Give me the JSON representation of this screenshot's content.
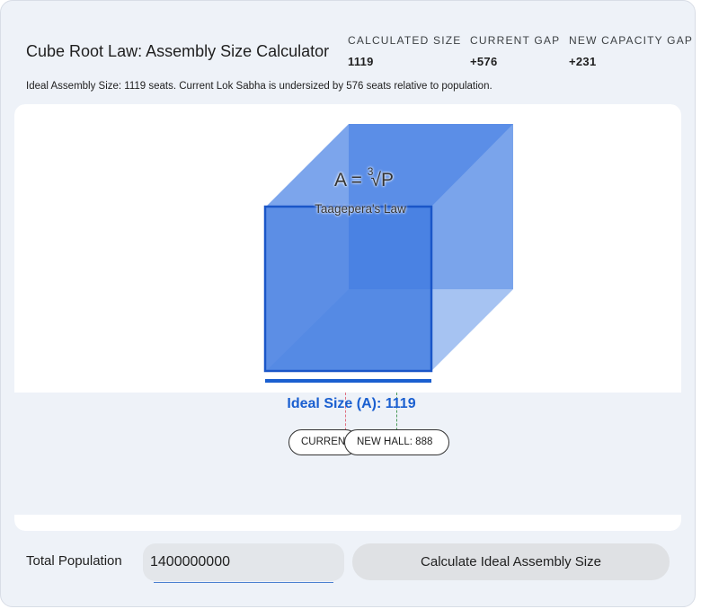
{
  "header": {
    "title": "Cube Root Law: Assembly Size Calculator",
    "stats": [
      {
        "label": "Calculated Size",
        "value": "1119"
      },
      {
        "label": "Current Gap",
        "value": "+576"
      },
      {
        "label": "New Capacity Gap",
        "value": "+231"
      }
    ],
    "summary": "Ideal Assembly Size: 1119 seats. Current Lok Sabha is undersized by 576 seats relative to population."
  },
  "visual": {
    "formula_prefix": "A = ",
    "formula_index": "3",
    "formula_radical": "√",
    "formula_var": "P",
    "law_name": "Taagepera's Law",
    "ideal_label": "Ideal Size (A): 1119",
    "markers": {
      "current_label": "CURRENT: 543",
      "new_hall_label": "NEW HALL: 888"
    },
    "colors": {
      "cube_front": "#3f7ae0",
      "cube_back": "#5b8fe6",
      "accent_blue": "#1a5fd0",
      "current_marker": "#e07080",
      "new_marker": "#4a9a5a"
    }
  },
  "controls": {
    "population_label": "Total Population",
    "population_value": "1400000000",
    "calculate_label": "Calculate Ideal Assembly Size"
  }
}
